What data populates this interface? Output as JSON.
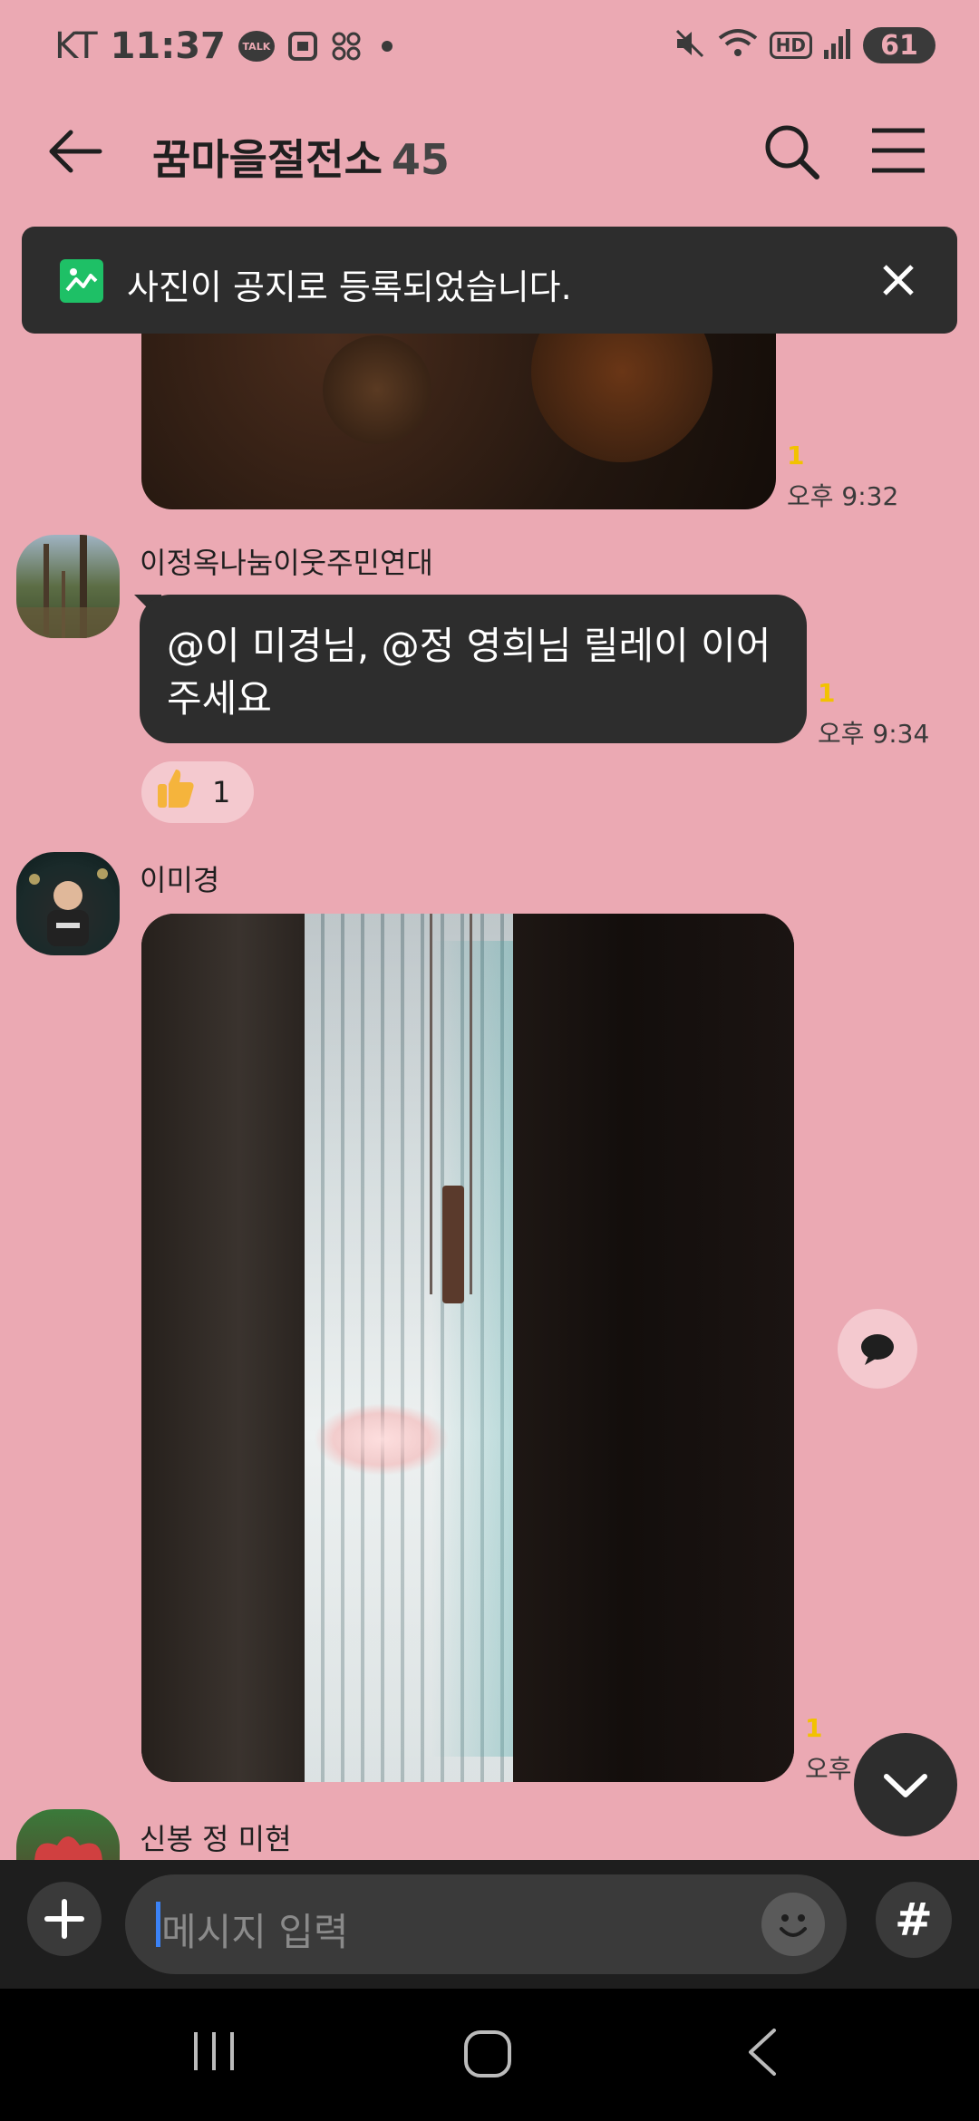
{
  "status_bar": {
    "carrier": "KT",
    "time": "11:37",
    "talk_label": "TALK",
    "hd_label": "HD",
    "battery": "61"
  },
  "header": {
    "title": "꿈마을절전소",
    "member_count": "45"
  },
  "notice_toast": {
    "text": "사진이 공지로 등록되었습니다."
  },
  "messages": [
    {
      "type": "photo",
      "unread": "1",
      "time": "오후 9:32"
    },
    {
      "type": "text",
      "sender": "이정옥나눔이웃주민연대",
      "line1": "@이 미경님, @정 영희님 릴레이 이어",
      "line2": "주세요",
      "unread": "1",
      "time": "오후 9:34",
      "reaction": {
        "emoji": "thumbs-up",
        "count": "1"
      }
    },
    {
      "type": "photo",
      "sender": "이미경",
      "unread": "1",
      "time": "오후"
    },
    {
      "type": "partial",
      "sender": "신봉 정 미현"
    }
  ],
  "composer": {
    "placeholder": "메시지 입력",
    "hash_label": "#"
  },
  "colors": {
    "chat_background": "#eba9b3",
    "bubble": "#2d2d2d",
    "unread": "#f2c200",
    "notice_icon": "#1ec066"
  }
}
